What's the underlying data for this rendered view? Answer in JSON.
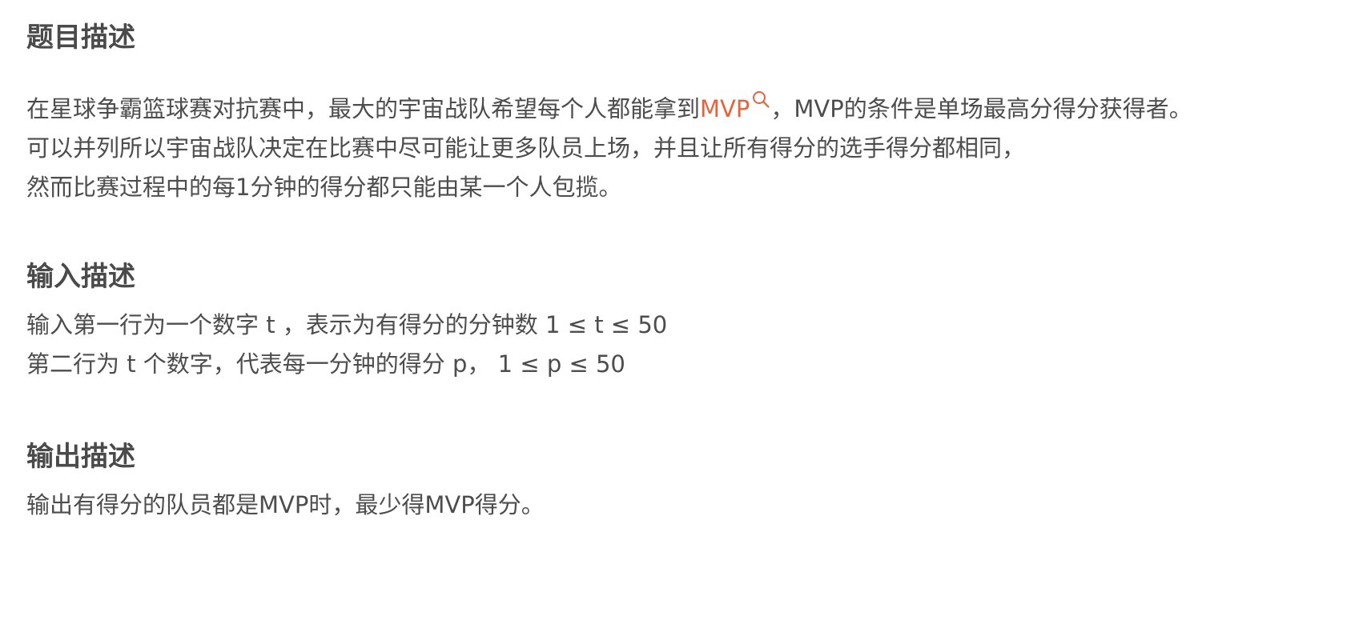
{
  "sections": [
    {
      "title": "题目描述",
      "lines": [
        {
          "before": "在星球争霸篮球赛对抗赛中，最大的宇宙战队希望每个人都能拿到",
          "link": "MVP",
          "after": "，MVP的条件是单场最高分得分获得者。"
        },
        "可以并列所以宇宙战队决定在比赛中尽可能让更多队员上场，并且让所有得分的选手得分都相同，",
        "然而比赛过程中的每1分钟的得分都只能由某一个人包揽。"
      ]
    },
    {
      "title": "输入描述",
      "lines": [
        "输入第一行为一个数字 t ，表示为有得分的分钟数 1 ≤ t ≤ 50",
        "第二行为 t 个数字，代表每一分钟的得分 p，  1 ≤ p ≤ 50"
      ]
    },
    {
      "title": "输出描述",
      "lines": [
        "输出有得分的队员都是MVP时，最少得MVP得分。"
      ]
    }
  ],
  "colors": {
    "link": "#e5633d",
    "text": "#4d4d4d",
    "heading": "#4a4a4a"
  },
  "icons": {
    "link_search": "search-icon"
  }
}
